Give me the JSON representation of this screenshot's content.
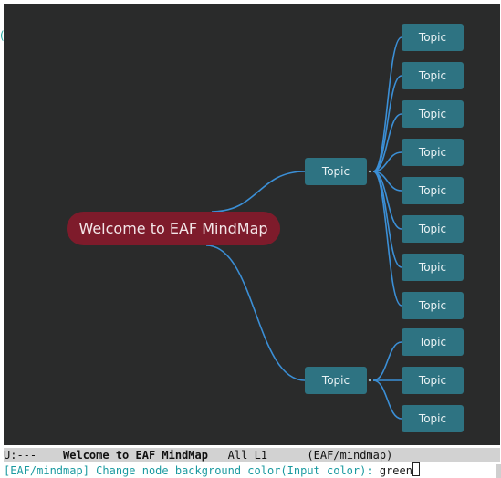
{
  "colors": {
    "canvas_bg": "#2a2b2b",
    "edge": "#3b8fd6",
    "topic_bg": "#2e7382",
    "root_bg": "#7e1b2b",
    "prompt_color": "#1a9aa0"
  },
  "mindmap": {
    "root": {
      "label": "Welcome to EAF MindMap"
    },
    "branches": [
      {
        "label": "Topic",
        "children": [
          "Topic",
          "Topic",
          "Topic",
          "Topic",
          "Topic",
          "Topic",
          "Topic",
          "Topic"
        ]
      },
      {
        "label": "Topic",
        "children": [
          "Topic",
          "Topic",
          "Topic"
        ]
      }
    ]
  },
  "modeline": {
    "status": "U:---",
    "buffer_name": "Welcome to EAF MindMap",
    "position": "All L1",
    "mode": "(EAF/mindmap)"
  },
  "minibuffer": {
    "prompt": "[EAF/mindmap] Change node background color(Input color): ",
    "input": "green"
  }
}
